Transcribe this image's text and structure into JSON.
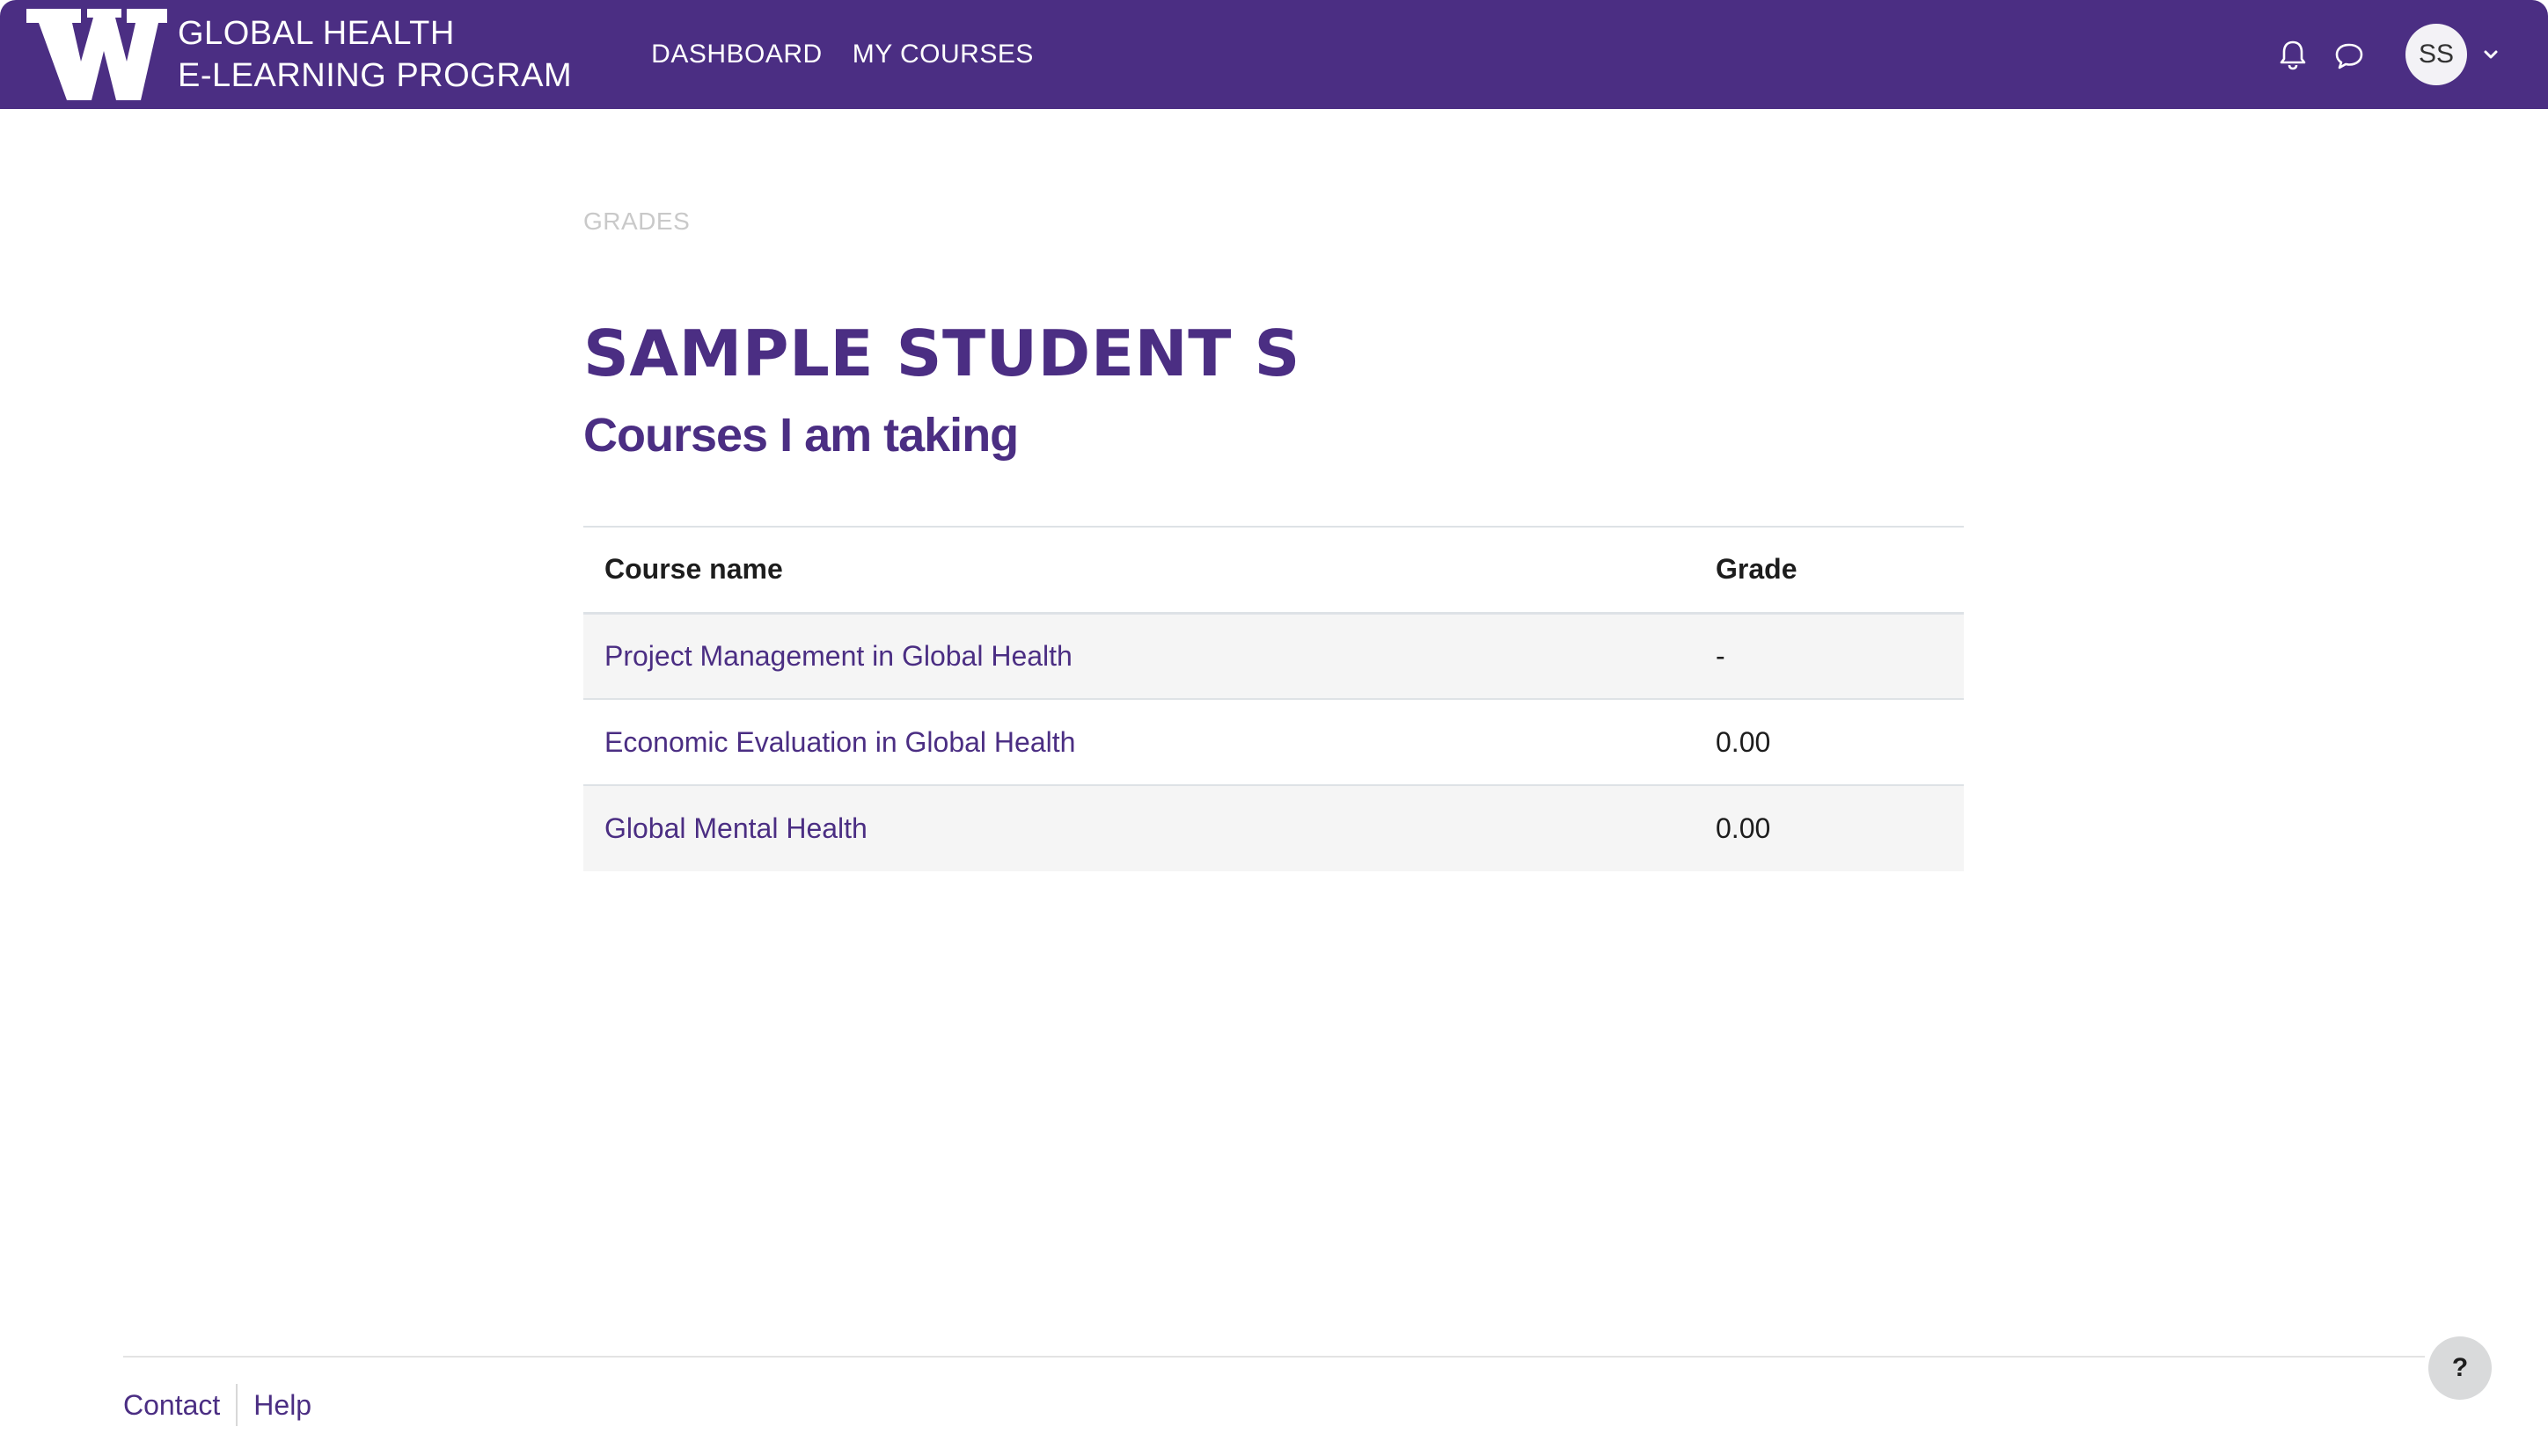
{
  "header": {
    "brand_line1": "GLOBAL HEALTH",
    "brand_line2": "E-LEARNING PROGRAM",
    "nav": [
      {
        "label": "DASHBOARD"
      },
      {
        "label": "MY COURSES"
      }
    ],
    "user_initials": "SS",
    "background_color": "#4b2e83"
  },
  "icons": {
    "logo": "uw-w-logo-icon",
    "notifications": "bell-icon",
    "messages": "chat-bubble-icon",
    "user_menu": "chevron-down-icon",
    "help": "question-icon"
  },
  "breadcrumb": "GRADES",
  "page": {
    "title": "SAMPLE STUDENT S",
    "subtitle": "Courses I am taking"
  },
  "table": {
    "headers": {
      "course": "Course name",
      "grade": "Grade"
    },
    "rows": [
      {
        "course": "Project Management in Global Health",
        "grade": "-"
      },
      {
        "course": "Economic Evaluation in Global Health",
        "grade": "0.00"
      },
      {
        "course": "Global Mental Health",
        "grade": "0.00"
      }
    ]
  },
  "footer": {
    "contact": "Contact",
    "help": "Help",
    "help_button": "?"
  },
  "colors": {
    "accent": "#4b2e83",
    "row_stripe": "#f5f5f5"
  }
}
